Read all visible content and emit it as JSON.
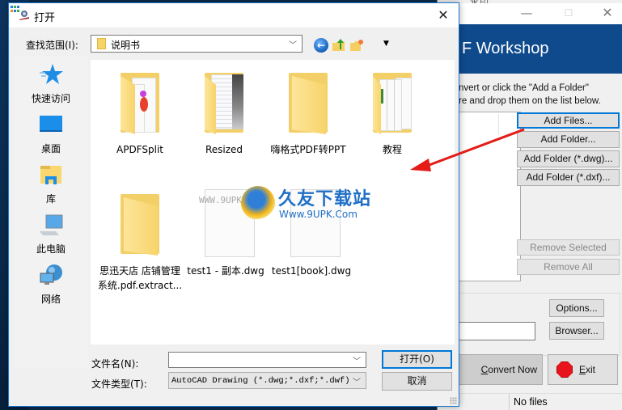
{
  "main_window": {
    "title_clip": "水印",
    "banner_title": "F Workshop",
    "instructions": [
      "nvert or click the \"Add a Folder\"",
      "re and drop them on the list below."
    ],
    "buttons": {
      "add_files": "Add Files...",
      "add_folder": "Add Folder...",
      "add_folder_dwg": "Add Folder (*.dwg)...",
      "add_folder_dxf": "Add Folder (*.dxf)...",
      "remove_selected": "Remove Selected",
      "remove_all": "Remove All",
      "options": "Options...",
      "browser": "Browser...",
      "convert_now_accel": "C",
      "convert_now_rest": "onvert Now",
      "exit_accel": "E",
      "exit_rest": "xit"
    },
    "output_path": "",
    "status": "No files",
    "window_controls": {
      "minimize": "—",
      "maximize": "☐",
      "close": "✕"
    }
  },
  "dialog": {
    "title": "打开",
    "close_glyph": "✕",
    "look_in_label": "查找范围(I):",
    "look_in_value": "说明书",
    "toolbar": {
      "back": "back-icon",
      "up": "up-folder-icon",
      "new_folder": "new-folder-icon",
      "view_menu": "view-menu-icon"
    },
    "places": [
      {
        "label": "快速访问",
        "icon": "quick-access-icon"
      },
      {
        "label": "桌面",
        "icon": "desktop-icon"
      },
      {
        "label": "库",
        "icon": "library-icon"
      },
      {
        "label": "此电脑",
        "icon": "this-pc-icon"
      },
      {
        "label": "网络",
        "icon": "network-icon"
      }
    ],
    "items": [
      {
        "name": "APDFSplit",
        "type": "folder"
      },
      {
        "name": "Resized",
        "type": "folder"
      },
      {
        "name": "嗨格式PDF转PPT",
        "type": "folder"
      },
      {
        "name": "教程",
        "type": "folder"
      },
      {
        "name": "思迅天店 店铺管理系统.pdf.extract...",
        "type": "folder"
      },
      {
        "name": "test1 - 副本.dwg",
        "type": "file"
      },
      {
        "name": "test1[book].dwg",
        "type": "file"
      }
    ],
    "file_name_label": "文件名(N):",
    "file_name_value": "",
    "file_type_label": "文件类型(T):",
    "file_type_value": "AutoCAD Drawing (*.dwg;*.dxf;*.dwf)",
    "open_button": "打开(O)",
    "cancel_button": "取消"
  },
  "watermark": {
    "cn": "久友下载站",
    "en": "Www.9UPK.Com",
    "url": "WWW.9UPK.COM"
  }
}
